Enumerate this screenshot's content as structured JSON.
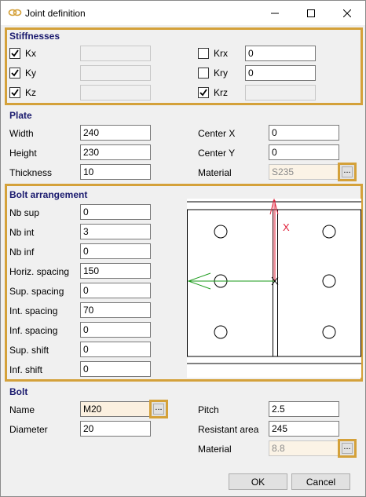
{
  "window": {
    "title": "Joint definition",
    "buttons": {
      "minimize": "minimize-icon",
      "maximize": "maximize-icon",
      "close": "close-icon"
    }
  },
  "colors": {
    "section_border": "#d4a13a",
    "section_title": "#1a1a6e",
    "arrow_x": "#e0203a",
    "arrow_y": "#1a9a1a"
  },
  "stiffnesses": {
    "title": "Stiffnesses",
    "kx": {
      "label": "Kx",
      "checked": true,
      "value": ""
    },
    "ky": {
      "label": "Ky",
      "checked": true,
      "value": ""
    },
    "kz": {
      "label": "Kz",
      "checked": true,
      "value": ""
    },
    "krx": {
      "label": "Krx",
      "checked": false,
      "value": "0"
    },
    "kry": {
      "label": "Kry",
      "checked": false,
      "value": "0"
    },
    "krz": {
      "label": "Krz",
      "checked": true,
      "value": ""
    }
  },
  "plate": {
    "title": "Plate",
    "width": {
      "label": "Width",
      "value": "240"
    },
    "height": {
      "label": "Height",
      "value": "230"
    },
    "thickness": {
      "label": "Thickness",
      "value": "10"
    },
    "center_x": {
      "label": "Center X",
      "value": "0"
    },
    "center_y": {
      "label": "Center Y",
      "value": "0"
    },
    "material": {
      "label": "Material",
      "value": "S235",
      "button": "..."
    }
  },
  "bolt_arrangement": {
    "title": "Bolt arrangement",
    "nb_sup": {
      "label": "Nb sup",
      "value": "0"
    },
    "nb_int": {
      "label": "Nb int",
      "value": "3"
    },
    "nb_inf": {
      "label": "Nb inf",
      "value": "0"
    },
    "horiz_spacing": {
      "label": "Horiz. spacing",
      "value": "150"
    },
    "sup_spacing": {
      "label": "Sup. spacing",
      "value": "0"
    },
    "int_spacing": {
      "label": "Int. spacing",
      "value": "70"
    },
    "inf_spacing": {
      "label": "Inf. spacing",
      "value": "0"
    },
    "sup_shift": {
      "label": "Sup. shift",
      "value": "0"
    },
    "inf_shift": {
      "label": "Inf. shift",
      "value": "0"
    },
    "diagram": {
      "axis_label": "X"
    }
  },
  "bolt": {
    "title": "Bolt",
    "name": {
      "label": "Name",
      "value": "M20",
      "button": "..."
    },
    "diameter": {
      "label": "Diameter",
      "value": "20"
    },
    "pitch": {
      "label": "Pitch",
      "value": "2.5"
    },
    "resistant_area": {
      "label": "Resistant area",
      "value": "245"
    },
    "material": {
      "label": "Material",
      "value": "8.8",
      "button": "..."
    }
  },
  "footer": {
    "ok": "OK",
    "cancel": "Cancel"
  }
}
